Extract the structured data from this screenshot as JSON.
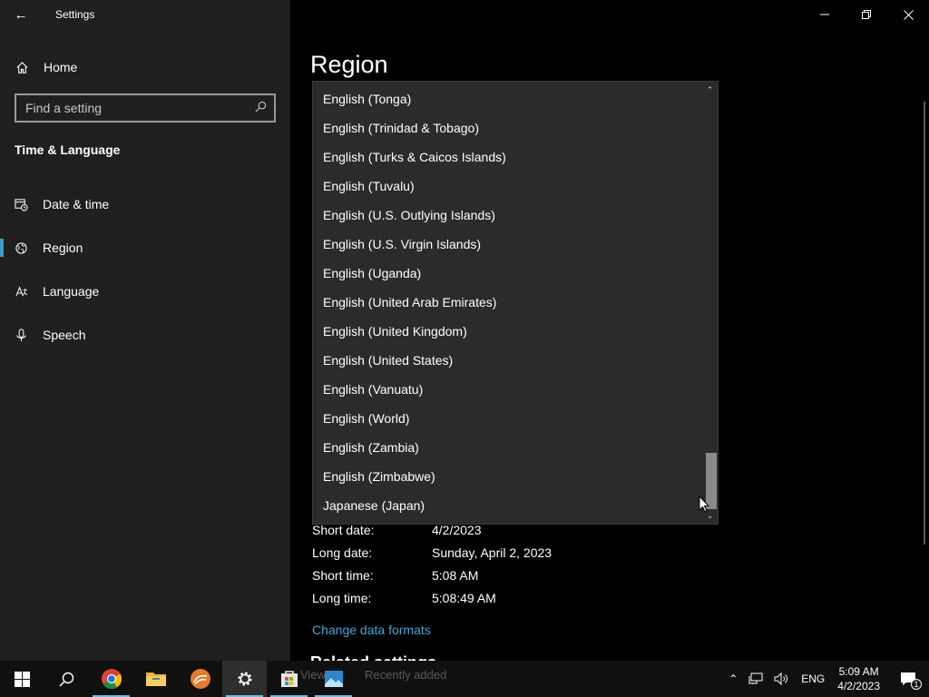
{
  "app": {
    "title": "Settings"
  },
  "sidebar": {
    "home": "Home",
    "search_placeholder": "Find a setting",
    "section": "Time & Language",
    "items": [
      {
        "label": "Date & time",
        "icon": "date-time-icon"
      },
      {
        "label": "Region",
        "icon": "region-icon",
        "active": true
      },
      {
        "label": "Language",
        "icon": "language-icon"
      },
      {
        "label": "Speech",
        "icon": "microphone-icon"
      }
    ]
  },
  "main": {
    "title": "Region",
    "dropdown": {
      "options": [
        "English (Tonga)",
        "English (Trinidad & Tobago)",
        "English (Turks & Caicos Islands)",
        "English (Tuvalu)",
        "English (U.S. Outlying Islands)",
        "English (U.S. Virgin Islands)",
        "English (Uganda)",
        "English (United Arab Emirates)",
        "English (United Kingdom)",
        "English (United States)",
        "English (Vanuatu)",
        "English (World)",
        "English (Zambia)",
        "English (Zimbabwe)",
        "Japanese (Japan)"
      ]
    },
    "formats": [
      {
        "label": "Short date:",
        "value": "4/2/2023"
      },
      {
        "label": "Long date:",
        "value": "Sunday, April 2, 2023"
      },
      {
        "label": "Short time:",
        "value": "5:08 AM"
      },
      {
        "label": "Long time:",
        "value": "5:08:49 AM"
      }
    ],
    "change_link": "Change data formats",
    "related_heading": "Related settings"
  },
  "taskbar": {
    "faded_text_1": "View",
    "faded_text_2": "Recently added",
    "lang": "ENG",
    "time": "5:09 AM",
    "date": "4/2/2023",
    "notification_count": "1"
  },
  "colors": {
    "accent": "#3a9ec4",
    "link": "#3fa7d8",
    "sidebar_bg": "#1f1f1f",
    "dropdown_bg": "#2b2b2b"
  }
}
